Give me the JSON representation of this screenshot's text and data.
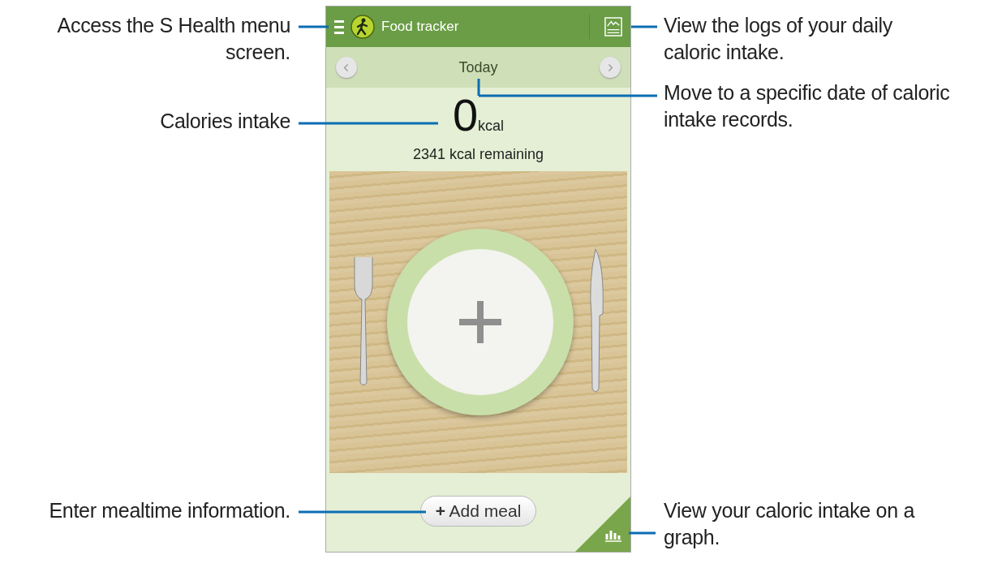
{
  "app": {
    "title": "Food tracker"
  },
  "date_nav": {
    "label": "Today"
  },
  "intake": {
    "value": "0",
    "unit": "kcal",
    "remaining": "2341 kcal remaining"
  },
  "add_meal_button": {
    "icon": "+",
    "label": "Add meal"
  },
  "left_callouts": [
    {
      "text": "Access the S Health menu screen."
    },
    {
      "text": "Calories intake"
    },
    {
      "text": "Enter mealtime information."
    }
  ],
  "right_callouts": [
    {
      "text": "View the logs of your daily caloric intake."
    },
    {
      "text": "Move to a specific date of caloric intake records."
    },
    {
      "text": "View your caloric intake on a graph."
    }
  ]
}
